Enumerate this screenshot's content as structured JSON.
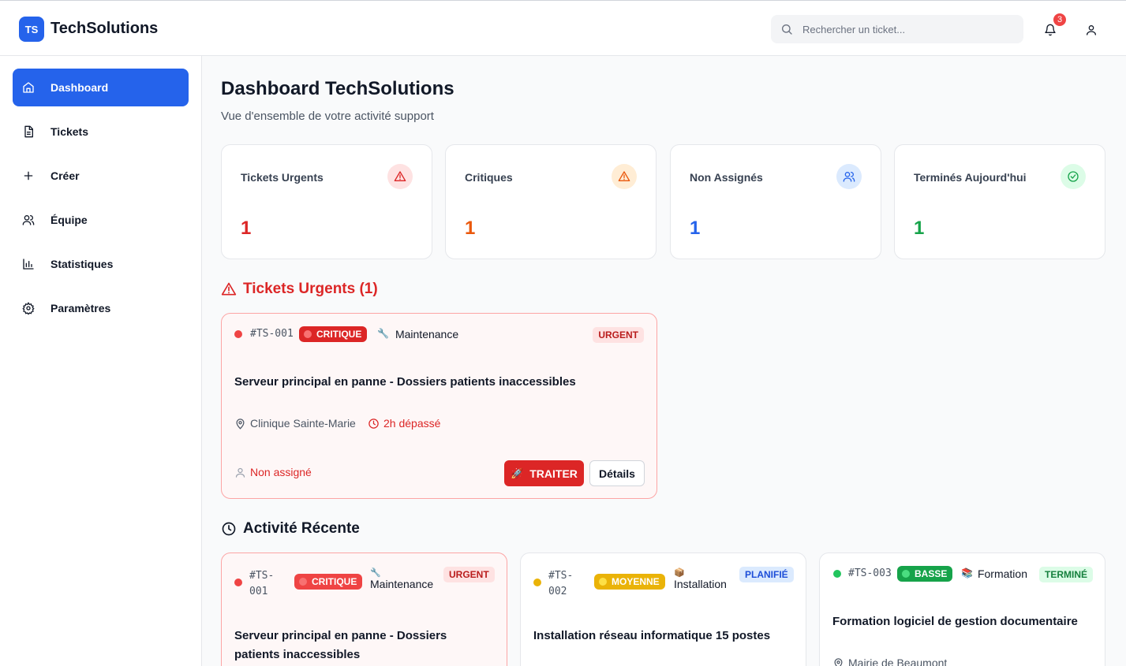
{
  "app": {
    "logo_initials": "TS",
    "name": "TechSolutions"
  },
  "header": {
    "search_placeholder": "Rechercher un ticket...",
    "notification_count": "3"
  },
  "sidebar": {
    "items": [
      {
        "label": "Dashboard",
        "icon": "home-icon",
        "active": true
      },
      {
        "label": "Tickets",
        "icon": "document-icon"
      },
      {
        "label": "Créer",
        "icon": "plus-icon"
      },
      {
        "label": "Équipe",
        "icon": "users-icon"
      },
      {
        "label": "Statistiques",
        "icon": "bar-chart-icon"
      },
      {
        "label": "Paramètres",
        "icon": "gear-icon"
      }
    ]
  },
  "page": {
    "title": "Dashboard TechSolutions",
    "subtitle": "Vue d'ensemble de votre activité support"
  },
  "stats": [
    {
      "label": "Tickets Urgents",
      "value": "1",
      "color": "#dc2626",
      "bg": "#fee2e2",
      "icon": "alert-triangle-icon"
    },
    {
      "label": "Critiques",
      "value": "1",
      "color": "#ea580c",
      "bg": "#ffedd5",
      "icon": "alert-triangle-icon"
    },
    {
      "label": "Non Assignés",
      "value": "1",
      "color": "#2563eb",
      "bg": "#dbeafe",
      "icon": "users-icon"
    },
    {
      "label": "Terminés Aujourd'hui",
      "value": "1",
      "color": "#16a34a",
      "bg": "#dcfce7",
      "icon": "check-circle-icon"
    }
  ],
  "urgent_section": {
    "title": "Tickets Urgents (1)",
    "ticket": {
      "id": "#TS-001",
      "priority": "CRITIQUE",
      "category": "Maintenance",
      "status": "URGENT",
      "title": "Serveur principal en panne - Dossiers patients inaccessibles",
      "location": "Clinique Sainte-Marie",
      "time": "2h dépassé",
      "assignee": "Non assigné",
      "action_primary": "TRAITER",
      "action_secondary": "Détails"
    }
  },
  "recent_section": {
    "title": "Activité Récente",
    "tickets": [
      {
        "id_line1": "#TS-",
        "id_line2": "001",
        "priority": "CRITIQUE",
        "category": "Maintenance",
        "status": "URGENT",
        "title_line1": "Serveur principal en panne - Dossiers",
        "title_line2": "patients inaccessibles"
      },
      {
        "id_line1": "#TS-",
        "id_line2": "002",
        "priority": "MOYENNE",
        "category": "Installation",
        "status": "PLANIFIÉ",
        "title": "Installation réseau informatique 15 postes"
      },
      {
        "id": "#TS-003",
        "priority": "BASSE",
        "category": "Formation",
        "status": "TERMINÉ",
        "title": "Formation logiciel de gestion documentaire",
        "location": "Mairie de Beaumont"
      }
    ]
  },
  "colors": {
    "accent": "#2563eb",
    "critical": "#dc2626",
    "medium": "#eab308",
    "low": "#16a34a"
  }
}
